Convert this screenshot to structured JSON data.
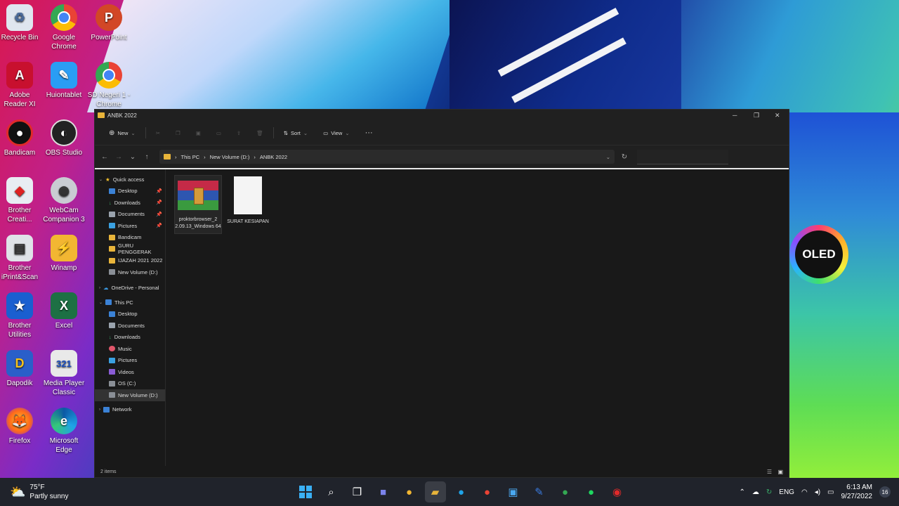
{
  "desktop_icons": [
    {
      "label": "Recycle Bin",
      "icon": "recycle-bin-icon"
    },
    {
      "label": "Google Chrome",
      "icon": "chrome-icon"
    },
    {
      "label": "PowerPoint",
      "icon": "powerpoint-icon"
    },
    {
      "label": "Adobe Reader XI",
      "icon": "adobe-reader-icon"
    },
    {
      "label": "Huiontablet",
      "icon": "huion-icon"
    },
    {
      "label": "SD Negeri 1 - Chrome",
      "icon": "chrome-profile-icon"
    },
    {
      "label": "Bandicam",
      "icon": "bandicam-icon"
    },
    {
      "label": "OBS Studio",
      "icon": "obs-icon"
    },
    {
      "label": "Brother Creati...",
      "icon": "brother-creative-icon"
    },
    {
      "label": "WebCam Companion 3",
      "icon": "webcam-icon"
    },
    {
      "label": "Brother iPrint&Scan",
      "icon": "brother-print-icon"
    },
    {
      "label": "Winamp",
      "icon": "winamp-icon"
    },
    {
      "label": "Brother Utilities",
      "icon": "brother-utilities-icon"
    },
    {
      "label": "Excel",
      "icon": "excel-icon"
    },
    {
      "label": "Dapodik",
      "icon": "dapodik-icon"
    },
    {
      "label": "Media Player Classic",
      "icon": "media-player-icon"
    },
    {
      "label": "Firefox",
      "icon": "firefox-icon"
    },
    {
      "label": "Microsoft Edge",
      "icon": "edge-icon"
    }
  ],
  "wallpaper_badge": "OLED",
  "window": {
    "title": "ANBK 2022",
    "toolbar": {
      "new": "New",
      "sort": "Sort",
      "view": "View",
      "more": "···"
    },
    "breadcrumb": [
      "This PC",
      "New Volume (D:)",
      "ANBK 2022"
    ],
    "nav_pane": {
      "quick_access": "Quick access",
      "quick_items": [
        {
          "label": "Desktop",
          "pinned": true
        },
        {
          "label": "Downloads",
          "pinned": true
        },
        {
          "label": "Documents",
          "pinned": true
        },
        {
          "label": "Pictures",
          "pinned": true
        },
        {
          "label": "Bandicam",
          "pinned": false
        },
        {
          "label": "GURU PENGGERAK",
          "pinned": false
        },
        {
          "label": "IJAZAH 2021 2022",
          "pinned": false
        },
        {
          "label": "New Volume (D:)",
          "pinned": false
        }
      ],
      "onedrive": "OneDrive - Personal",
      "this_pc": "This PC",
      "pc_items": [
        "Desktop",
        "Documents",
        "Downloads",
        "Music",
        "Pictures",
        "Videos",
        "OS (C:)",
        "New Volume (D:)"
      ],
      "network": "Network"
    },
    "files": [
      {
        "name": "proktorbrowser_2 2.09.13_Windows 64",
        "icon": "winrar-archive-icon"
      },
      {
        "name": "SURAT KESIAPAN",
        "icon": "document-thumbnail-icon"
      }
    ],
    "status": "2 items"
  },
  "taskbar": {
    "weather_temp": "75°F",
    "weather_desc": "Partly sunny",
    "lang": "ENG",
    "time": "6:13 AM",
    "date": "9/27/2022",
    "notif_count": "16"
  },
  "colors": {
    "folder": "#e8b43a",
    "accent": "#0078d4"
  }
}
